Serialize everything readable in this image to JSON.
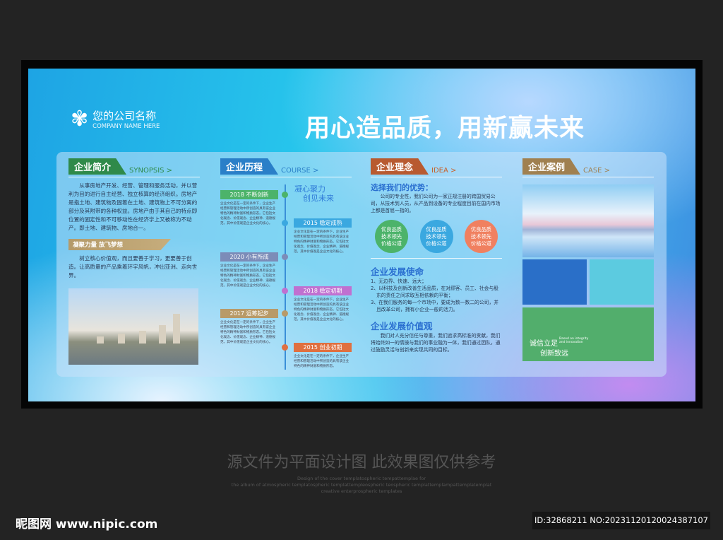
{
  "header": {
    "company_cn": "您的公司名称",
    "company_en": "COMPANY NAME HERE",
    "slogan": "用心造品质，用新赢未来"
  },
  "synopsis": {
    "title": "企业简介",
    "en": "SYNOPSIS >",
    "color": "#2f8a4a",
    "text": "从事房地产开发、经营、管理和服务活动，并以营利为目的进行自主经营、独立核算的经济组织。房地产是指土地、建筑物及固着在土地、建筑物上不可分离的部分及其附带的各种权益。房地产由于其自己的特点即位置的固定性和不可移动性在经济学上又被称为不动产。即土地、建筑物、房地合一。",
    "sub_title": "凝聚力量 放飞梦想",
    "sub_text": "树立核心价值观，而且要善于学习，更要善于创造。让高质量的产品乘着环宇风帆，冲出亚洲、走向世界。"
  },
  "course": {
    "title": "企业历程",
    "en": "COURSE >",
    "color": "#2a7fc8",
    "motto1": "凝心聚力",
    "motto2": "创见未来",
    "items": [
      {
        "label": "2018 不断创新",
        "color": "#4cb36a",
        "text": "企业文化是在一定的条件下，企业生产经营和管理活动中所创造的具有该企业特色的精神财富和物质形态。它包括文化观念、价值观念、企业精神、道德规范，其中价值观是企业文化的核心。"
      },
      {
        "label": "2015 稳定成熟",
        "color": "#3aa8e0",
        "text": "企业文化是在一定的条件下，企业生产经营和管理活动中所创造的具有该企业特色的精神财富和物质形态。它包括文化观念、价值观念、企业精神、道德规范，其中价值观是企业文化的核心。"
      },
      {
        "label": "2020 小有所成",
        "color": "#7c8cb8",
        "text": "企业文化是在一定的条件下，企业生产经营和管理活动中所创造的具有该企业特色的精神财富和物质形态。它包括文化观念、价值观念、企业精神、道德规范，其中价值观是企业文化的核心。"
      },
      {
        "label": "2018 稳定初期",
        "color": "#c070d0",
        "text": "企业文化是在一定的条件下，企业生产经营和管理活动中所创造的具有该企业特色的精神财富和物质形态。它包括文化观念、价值观念、企业精神、道德规范，其中价值观是企业文化的核心。"
      },
      {
        "label": "2017 运筹起步",
        "color": "#b89a68",
        "text": "企业文化是在一定的条件下，企业生产经营和管理活动中所创造的具有该企业特色的精神财富和物质形态。它包括文化观念、价值观念、企业精神、道德规范，其中价值观是企业文化的核心。"
      },
      {
        "label": "2015 创业初期",
        "color": "#e07040",
        "text": "企业文化是在一定的条件下，企业生产经营和管理活动中所创造的具有该企业特色的精神财富和物质形态。"
      }
    ]
  },
  "idea": {
    "title": "企业理念",
    "en": "IDEA >",
    "color": "#b85a30",
    "adv_title": "选择我们的优势：",
    "adv_text": "公司的专业性，我们公司为一家正规注册的跨国贸易公司，从技术到人员，从产品到设备的专业程度目前在国内市场上都是首屈一指的。",
    "circles": [
      {
        "text": "优良品质 技术领先 价格公道",
        "color": "#4cb36a"
      },
      {
        "text": "优良品质 技术领先 价格公道",
        "color": "#3aa8e0"
      },
      {
        "text": "优良品质 技术领先 价格公道",
        "color": "#f08060"
      }
    ],
    "mission_title": "企业发展使命",
    "mission": [
      "1、无边界、快速、远大；",
      "2、以科技及创新改善生活品质，在对顾客、员工、社会与股东的责任之间求取互相依赖的平衡；",
      "3、在我们服务的每一个市场中，要成为数一数二的公司，并且改革公司，拥有小企业一般的活力。"
    ],
    "values_title": "企业发展价值观",
    "values_text": "我们对人充分信任与尊重，我们追求高标准的贡献，我们将始终如一的情操与我们的事业融为一体，我们通过团队，通过鼓励灵活与创新来实现共同的目标。"
  },
  "case": {
    "title": "企业案例",
    "en": "CASE >",
    "color": "#a08050",
    "motto1": "诚信立足",
    "motto2": "创新致远",
    "motto_en": "Based on integrity and innovation"
  },
  "footer": {
    "notice": "源文件为平面设计图 此效果图仅供参考",
    "en1": "Design of the cover templatospheric tempattemplae for",
    "en2": "the album of atmospheric templatospheric templattempleospheric teospheric templattemplampattemplatemplat",
    "en3": "creative enterprospheric templates",
    "site": "昵图网 www.nipic.com",
    "id": "ID:32868211 NO:20231120120024387107"
  }
}
